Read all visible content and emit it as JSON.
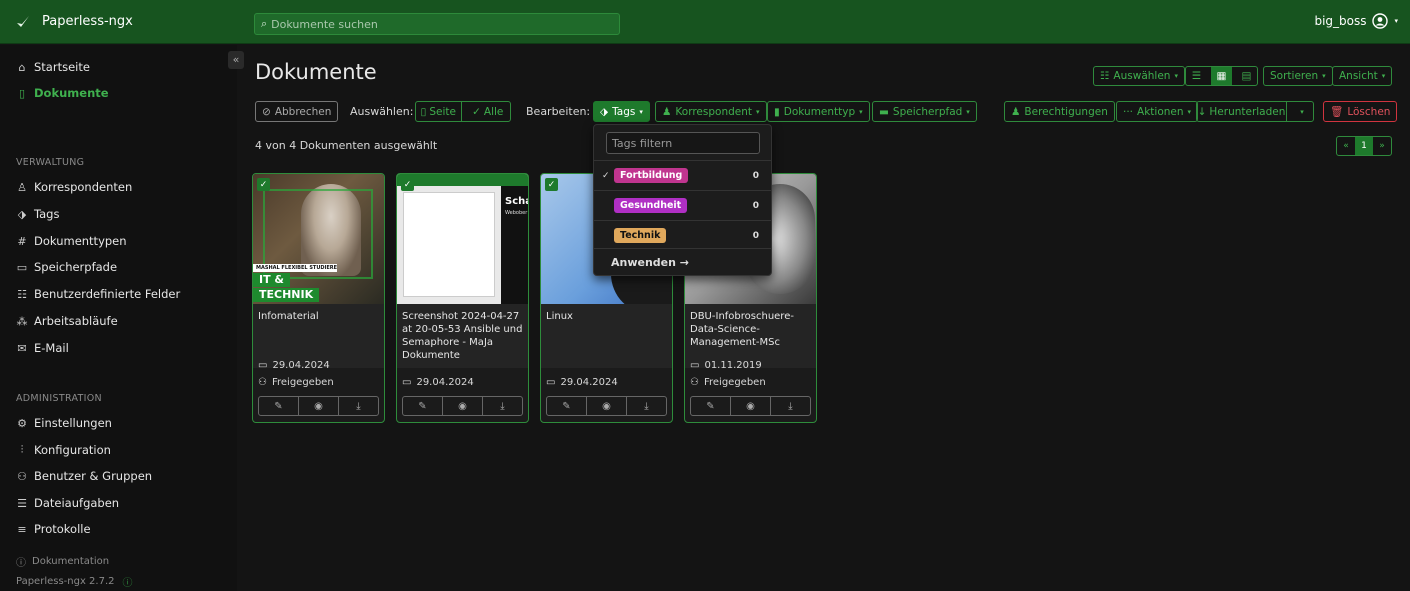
{
  "app": {
    "name": "Paperless-ngx"
  },
  "search": {
    "placeholder": "Dokumente suchen"
  },
  "user": {
    "name": "big_boss"
  },
  "sidebar": {
    "items": [
      {
        "label": "Startseite"
      },
      {
        "label": "Dokumente"
      }
    ],
    "section_manage": "VERWALTUNG",
    "manage_items": [
      {
        "label": "Korrespondenten"
      },
      {
        "label": "Tags"
      },
      {
        "label": "Dokumenttypen"
      },
      {
        "label": "Speicherpfade"
      },
      {
        "label": "Benutzerdefinierte Felder"
      },
      {
        "label": "Arbeitsabläufe"
      },
      {
        "label": "E-Mail"
      }
    ],
    "section_admin": "ADMINISTRATION",
    "admin_items": [
      {
        "label": "Einstellungen"
      },
      {
        "label": "Konfiguration"
      },
      {
        "label": "Benutzer & Gruppen"
      },
      {
        "label": "Dateiaufgaben"
      },
      {
        "label": "Protokolle"
      }
    ],
    "docs": "Dokumentation",
    "version": "Paperless-ngx 2.7.2"
  },
  "page": {
    "title": "Dokumente"
  },
  "toolbar": {
    "cancel": "Abbrechen",
    "select_label": "Auswählen:",
    "page": "Seite",
    "all": "Alle",
    "edit_label": "Bearbeiten:",
    "tags": "Tags",
    "correspondent": "Korrespondent",
    "doctype": "Dokumenttyp",
    "storagepath": "Speicherpfad",
    "permissions": "Berechtigungen",
    "actions": "Aktionen",
    "download": "Herunterladen",
    "delete": "Löschen",
    "select_menu": "Auswählen",
    "sort": "Sortieren",
    "view": "Ansicht"
  },
  "selection": {
    "text": "4 von 4 Dokumenten ausgewählt"
  },
  "pager": {
    "prev": "«",
    "current": "1",
    "next": "»"
  },
  "dropdown": {
    "filter_placeholder": "Tags filtern",
    "tags": [
      {
        "name": "Fortbildung",
        "count": "0",
        "checked": true,
        "color": "#c0358f"
      },
      {
        "name": "Gesundheit",
        "count": "0",
        "checked": false,
        "color": "#b02fc4"
      },
      {
        "name": "Technik",
        "count": "0",
        "checked": false,
        "color": "#e0a85c"
      }
    ],
    "apply": "Anwenden →"
  },
  "documents": [
    {
      "title": "Infomaterial",
      "date": "29.04.2024",
      "shared": "Freigegeben",
      "thumb_text_1": "IT &",
      "thumb_text_2": "TECHNIK",
      "thumb_text_3": "MASHAL FLEXIBEL STUDIEREN"
    },
    {
      "title": "Screenshot 2024-04-27 at 20-05-53 Ansible und Semaphore - MaJa Dokumente",
      "date": "29.04.2024",
      "shared": "",
      "thumb_text_1": "Scha",
      "thumb_text_2": "Webober"
    },
    {
      "title": "Linux",
      "date": "29.04.2024",
      "shared": ""
    },
    {
      "title": "DBU-Infobroschuere-Data-Science-Management-MSc",
      "date": "01.11.2019",
      "shared": "Freigegeben"
    }
  ]
}
